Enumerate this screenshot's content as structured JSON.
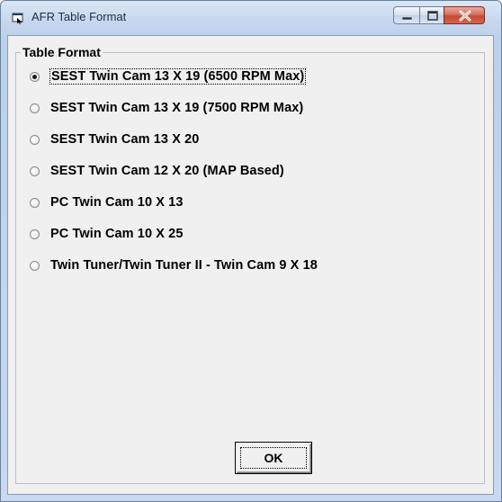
{
  "window": {
    "title": "AFR Table Format",
    "icon": "window-app-icon"
  },
  "controls": {
    "minimize_icon": "minimize-icon",
    "maximize_icon": "maximize-icon",
    "close_icon": "close-icon"
  },
  "group": {
    "label": "Table Format",
    "options": [
      {
        "label": "SEST Twin Cam 13 X 19 (6500 RPM Max)",
        "checked": true
      },
      {
        "label": "SEST Twin Cam 13 X 19 (7500 RPM Max)",
        "checked": false
      },
      {
        "label": "SEST Twin Cam 13 X 20",
        "checked": false
      },
      {
        "label": "SEST Twin Cam 12 X 20 (MAP Based)",
        "checked": false
      },
      {
        "label": "PC Twin Cam 10 X 13",
        "checked": false
      },
      {
        "label": "PC Twin Cam 10 X 25",
        "checked": false
      },
      {
        "label": "Twin Tuner/Twin Tuner II - Twin Cam 9 X 18",
        "checked": false
      }
    ]
  },
  "buttons": {
    "ok_label": "OK"
  }
}
